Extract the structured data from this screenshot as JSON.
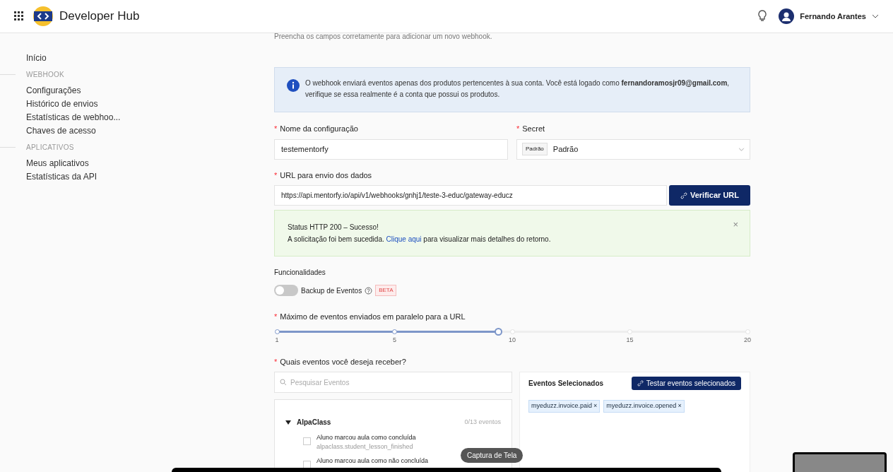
{
  "header": {
    "title": "Developer Hub",
    "user": "Fernando Arantes"
  },
  "sidebar": [
    {
      "kind": "item",
      "label": "Início"
    },
    {
      "kind": "section",
      "label": "WEBHOOK"
    },
    {
      "kind": "item",
      "label": "Configurações"
    },
    {
      "kind": "item",
      "label": "Histórico de envios"
    },
    {
      "kind": "item",
      "label": "Estatísticas de webhoo..."
    },
    {
      "kind": "item",
      "label": "Chaves de acesso"
    },
    {
      "kind": "section",
      "label": "APLICATIVOS"
    },
    {
      "kind": "item",
      "label": "Meus aplicativos"
    },
    {
      "kind": "item",
      "label": "Estatísticas da API"
    }
  ],
  "intro": "Preencha os campos corretamente para adicionar um novo webhook.",
  "info": "O webhook enviará eventos apenas dos produtos pertencentes à sua conta. Você está logado como **fernandoramosjr09@gmail.com**, verifique se essa realmente é a conta que possui os produtos.",
  "config_name": {
    "required_mark": "*",
    "label": "Nome da configuração",
    "value": "testementorfy"
  },
  "secret": {
    "required_mark": "*",
    "label": "Secret",
    "tag": "Padrão",
    "value": "Padrão"
  },
  "url": {
    "required_mark": "*",
    "label": "URL para envio dos dados",
    "value": "https://api.mentorfy.io/api/v1/webhooks/gnhj1/teste-3-educ/gateway-educz",
    "button": "Verificar URL"
  },
  "success": {
    "title": "Status HTTP 200 – Sucesso!",
    "text_before": "A solicitação foi bem sucedida.",
    "link": "Clique aqui",
    "text_after": "para visualizar mais detalhes do retorno.",
    "close": "×"
  },
  "features": {
    "label": "Funcionalidades",
    "toggle_label": "Backup de Eventos",
    "on": false,
    "badge": "BETA"
  },
  "parallel": {
    "required_mark": "*",
    "label": "Máximo de eventos enviados em paralelo para a URL",
    "level": 0.47,
    "marks": [
      "1",
      "5",
      "10",
      "15",
      "20"
    ]
  },
  "events": {
    "required_mark": "*",
    "label": "Quais eventos você deseja receber?",
    "search_placeholder": "Pesquisar Eventos",
    "groups": [
      {
        "name": "AlpaClass",
        "count": "0/13 eventos",
        "expanded": true,
        "items": [
          {
            "title": "Aluno marcou aula como concluída",
            "code": "alpaclass.student_lesson_finished",
            "checked": false
          },
          {
            "title": "Aluno marcou aula como não concluída",
            "checked": false
          }
        ]
      }
    ],
    "selected_title": "Eventos Selecionados",
    "test_button": "Testar eventos selecionados",
    "selected": [
      {
        "label": "myeduzz.invoice.paid",
        "remove": "×"
      },
      {
        "label": "myeduzz.invoice.opened",
        "remove": "×"
      }
    ]
  },
  "tooltip": "Captura de Tela"
}
